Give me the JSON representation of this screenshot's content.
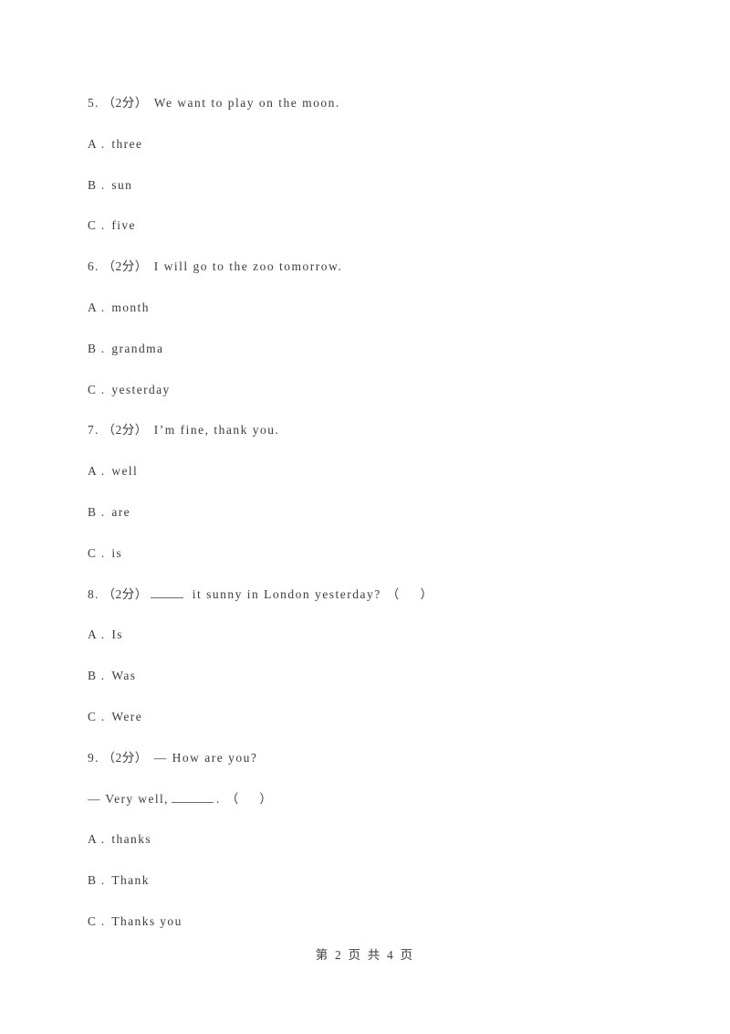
{
  "document": {
    "background_color": "#ffffff",
    "text_color": "#3c3c3c",
    "footer": "第 2 页 共 4 页",
    "page_number": "2",
    "total_pages": "4"
  },
  "questions": [
    {
      "number": "5.",
      "marks": "（2分）",
      "stem": "We want to play on the moon.",
      "options": [
        {
          "letter": "A .",
          "text": "three"
        },
        {
          "letter": "B .",
          "text": "sun"
        },
        {
          "letter": "C .",
          "text": "five"
        }
      ]
    },
    {
      "number": "6.",
      "marks": "（2分）",
      "stem": "I will go to the zoo tomorrow.",
      "options": [
        {
          "letter": "A .",
          "text": "month"
        },
        {
          "letter": "B .",
          "text": "grandma"
        },
        {
          "letter": "C .",
          "text": "yesterday"
        }
      ]
    },
    {
      "number": "7.",
      "marks": "（2分）",
      "stem": "I’m fine, thank you.",
      "options": [
        {
          "letter": "A .",
          "text": "well"
        },
        {
          "letter": "B .",
          "text": "are"
        },
        {
          "letter": "C .",
          "text": "is"
        }
      ]
    },
    {
      "number": "8.",
      "marks": "（2分）",
      "stem_after_blank": "it sunny in London yesterday?",
      "answer_paren_open": "（",
      "answer_paren_close": "）",
      "options": [
        {
          "letter": "A .",
          "text": "Is"
        },
        {
          "letter": "B .",
          "text": "Was"
        },
        {
          "letter": "C .",
          "text": "Were"
        }
      ]
    },
    {
      "number": "9.",
      "marks": "（2分）",
      "stem": "— How are you?",
      "stem_line2_before_blank": "— Very well,",
      "stem_line2_after_blank": ".",
      "answer_paren_open": "（",
      "answer_paren_close": "）",
      "options": [
        {
          "letter": "A .",
          "text": "thanks"
        },
        {
          "letter": "B .",
          "text": "Thank"
        },
        {
          "letter": "C .",
          "text": "Thanks you"
        }
      ]
    }
  ]
}
